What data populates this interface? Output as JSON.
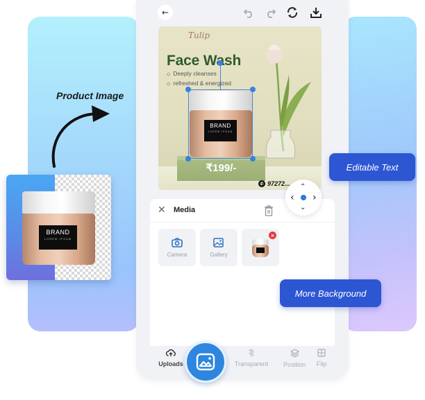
{
  "annotations": {
    "product_image": "Product Image",
    "editable_text": "Editable Text",
    "more_background": "More Background"
  },
  "jar": {
    "brand": "BRAND",
    "subtitle": "LOREM IPSUM"
  },
  "toolbar": {
    "back": "←",
    "icons": [
      "undo-icon",
      "redo-icon",
      "refresh-icon",
      "download-icon"
    ]
  },
  "canvas": {
    "script_word": "Tulip",
    "title": "Face Wash",
    "bullets": [
      "Deeply cleanses",
      "refreshed & energized"
    ],
    "price": "₹199/-",
    "phone": "97272..."
  },
  "nav_pad": {
    "up": "⌃",
    "down": "⌄",
    "left": "‹",
    "right": "›"
  },
  "media": {
    "title": "Media",
    "tiles": [
      {
        "label": "Camera",
        "icon": "camera-icon"
      },
      {
        "label": "Gallery",
        "icon": "gallery-icon"
      },
      {
        "label": "",
        "icon": "product-thumbnail"
      }
    ],
    "remove": "×",
    "close": "✕"
  },
  "bottom_nav": {
    "items": [
      {
        "label": "Uploads",
        "icon": "upload-cloud-icon",
        "active": true
      },
      {
        "label": "Transparent",
        "icon": "transparent-icon",
        "active": false
      },
      {
        "label": "Position",
        "icon": "layers-icon",
        "active": false
      },
      {
        "label": "Flip",
        "icon": "flip-icon",
        "active": false
      }
    ]
  },
  "colors": {
    "accent_blue": "#2e86de",
    "pill_blue": "#2d56d3",
    "title_green": "#2f5b2c",
    "remove_red": "#e53b3b"
  }
}
